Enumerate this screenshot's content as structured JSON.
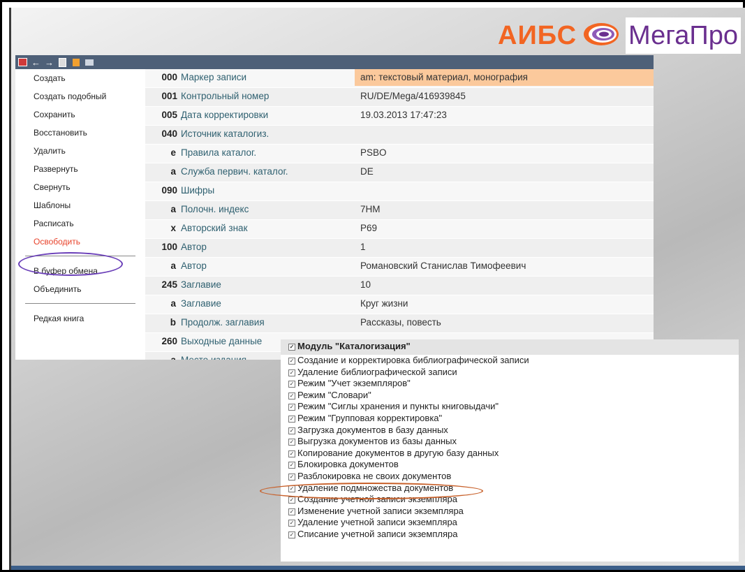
{
  "brand": {
    "left_text": "АИБС",
    "right_text": "МегаПро"
  },
  "colors": {
    "toolbar": "#4e6078",
    "accent_orange": "#f26522",
    "brand_purple": "#6a2f8f",
    "highlight": "#fbc99c"
  },
  "toolbar_icons": [
    "save-red-icon",
    "arrow-left-icon",
    "arrow-right-icon",
    "edit-doc-icon",
    "folder-icon",
    "list-icon"
  ],
  "sidebar": {
    "items": [
      "Создать",
      "Создать подобный",
      "Сохранить",
      "Восстановить",
      "Удалить",
      "Развернуть",
      "Свернуть",
      "Шаблоны",
      "Расписать",
      "Освободить"
    ],
    "items2": [
      "В буфер обмена",
      "Объединить"
    ],
    "items3": [
      "Редкая книга"
    ]
  },
  "records": [
    {
      "tag": "000",
      "label": "Маркер записи",
      "value": "am: текстовый материал, монография"
    },
    {
      "tag": "001",
      "label": "Контрольный номер",
      "value": "RU/DE/Mega/416939845"
    },
    {
      "tag": "005",
      "label": "Дата корректировки",
      "value": "19.03.2013 17:47:23"
    },
    {
      "tag": "040",
      "label": "Источник каталогиз.",
      "value": ""
    },
    {
      "tag": "e",
      "label": "Правила каталог.",
      "value": "PSBO"
    },
    {
      "tag": "a",
      "label": "Служба первич. каталог.",
      "value": "DE"
    },
    {
      "tag": "090",
      "label": "Шифры",
      "value": ""
    },
    {
      "tag": "a",
      "label": "Полочн. индекс",
      "value": "7НМ"
    },
    {
      "tag": "x",
      "label": "Авторский знак",
      "value": "Р69"
    },
    {
      "tag": "100",
      "label": "Автор",
      "value": "1"
    },
    {
      "tag": "a",
      "label": "Автор",
      "value": "Романовский Станислав Тимофеевич"
    },
    {
      "tag": "245",
      "label": "Заглавие",
      "value": "10"
    },
    {
      "tag": "a",
      "label": "Заглавие",
      "value": "Круг жизни"
    },
    {
      "tag": "b",
      "label": "Продолж. заглавия",
      "value": "Рассказы, повесть"
    },
    {
      "tag": "260",
      "label": "Выходные данные",
      "value": ""
    },
    {
      "tag": "a",
      "label": "Место издания",
      "value": ""
    }
  ],
  "permissions": {
    "title": "Модуль \"Каталогизация\"",
    "items": [
      "Создание и корректировка библиографической записи",
      "Удаление библиографической записи",
      "Режим \"Учет экземпляров\"",
      "Режим \"Словари\"",
      "Режим \"Сиглы хранения и пункты книговыдачи\"",
      "Режим \"Групповая корректировка\"",
      "Загрузка документов в базу данных",
      "Выгрузка документов из базы данных",
      "Копирование документов в другую базу данных",
      "Блокировка документов",
      "Разблокировка не своих документов",
      "Удаление подмножества документов",
      "Создание учетной записи экземпляра",
      "Изменение учетной записи экземпляра",
      "Удаление учетной записи экземпляра",
      "Списание учетной записи экземпляра"
    ]
  }
}
